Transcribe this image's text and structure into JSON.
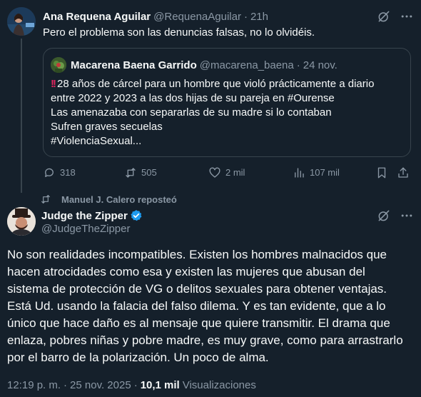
{
  "colors": {
    "background": "#15202b",
    "text_primary": "#f7f9f9",
    "text_secondary": "#8b98a5",
    "border": "#38444d",
    "verified": "#1d9bf0",
    "alarm": "#e0245e"
  },
  "reply_tweet": {
    "author_name": "Ana Requena Aguilar",
    "author_handle": "@RequenaAguilar",
    "time": "21h",
    "separator": "·",
    "text": "Pero el problema son las denuncias falsas, no lo olvidéis.",
    "quoted": {
      "author_name": "Macarena Baena Garrido",
      "author_handle": "@macarena_baena",
      "time": "24 nov.",
      "separator": "·",
      "alarm_emoji": "!!",
      "lines": [
        "28 años de cárcel para un hombre que violó prácticamente a diario",
        "entre 2022 y 2023 a las dos hijas de su pareja en #Ourense",
        "Las amenazaba con separarlas de su madre si lo contaban",
        "Sufren graves secuelas",
        "#ViolenciaSexual..."
      ]
    },
    "actions": {
      "replies": "318",
      "reposts": "505",
      "likes": "2 mil",
      "views": "107 mil"
    },
    "icons": [
      "reply-icon",
      "repost-icon",
      "like-icon",
      "views-icon",
      "bookmark-icon",
      "share-icon",
      "grok-icon",
      "more-icon"
    ]
  },
  "repost_bar": {
    "label": "Manuel J. Calero reposteó"
  },
  "main_tweet": {
    "author_name": "Judge the Zipper",
    "author_handle": "@JudgeTheZipper",
    "verified": true,
    "lines": [
      "No son realidades incompatibles. Existen los hombres malnacidos que",
      "hacen atrocidades como esa y existen las mujeres que abusan del",
      "sistema de protección de VG o delitos sexuales para obtener ventajas.",
      "Está Ud. usando la falacia del falso dilema. Y es tan evidente, que a lo",
      "único que hace daño es al mensaje que quiere transmitir. El drama que",
      "enlaza, pobres niñas y pobre madre, es muy grave, como para arrastrarlo",
      "por el barro de la polarización. Un poco de alma."
    ],
    "time": "12:19 p. m.",
    "date": "25 nov. 2025",
    "separator": "·",
    "views_count": "10,1 mil",
    "views_label": "Visualizaciones"
  }
}
